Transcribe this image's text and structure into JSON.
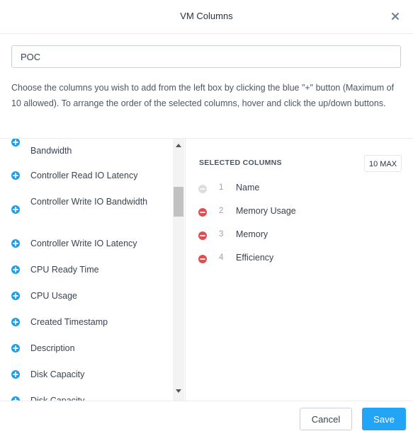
{
  "dialog": {
    "title": "VM Columns",
    "close_icon": "close-icon"
  },
  "name_field": {
    "value": "POC"
  },
  "instructions": "Choose the columns you wish to add from the left box by clicking the blue \"+\" button (Maximum of 10 allowed). To arrange the order of the selected columns, hover and click the up/down buttons.",
  "available_columns": [
    "Bandwidth",
    "Controller Read IO Latency",
    "Controller Write IO Bandwidth",
    "Controller Write IO Latency",
    "CPU Ready Time",
    "CPU Usage",
    "Created Timestamp",
    "Description",
    "Disk Capacity",
    "Disk Capacity"
  ],
  "selected": {
    "header": "SELECTED COLUMNS",
    "max_badge": "10 MAX",
    "items": [
      {
        "num": "1",
        "name": "Name",
        "removable": false
      },
      {
        "num": "2",
        "name": "Memory Usage",
        "removable": true
      },
      {
        "num": "3",
        "name": "Memory",
        "removable": true
      },
      {
        "num": "4",
        "name": "Efficiency",
        "removable": true
      }
    ]
  },
  "footer": {
    "cancel_label": "Cancel",
    "save_label": "Save"
  },
  "colors": {
    "add_icon": "#1a9fe8",
    "remove_icon": "#e44d4d",
    "remove_disabled": "#dddddd",
    "primary": "#22a5f7"
  }
}
